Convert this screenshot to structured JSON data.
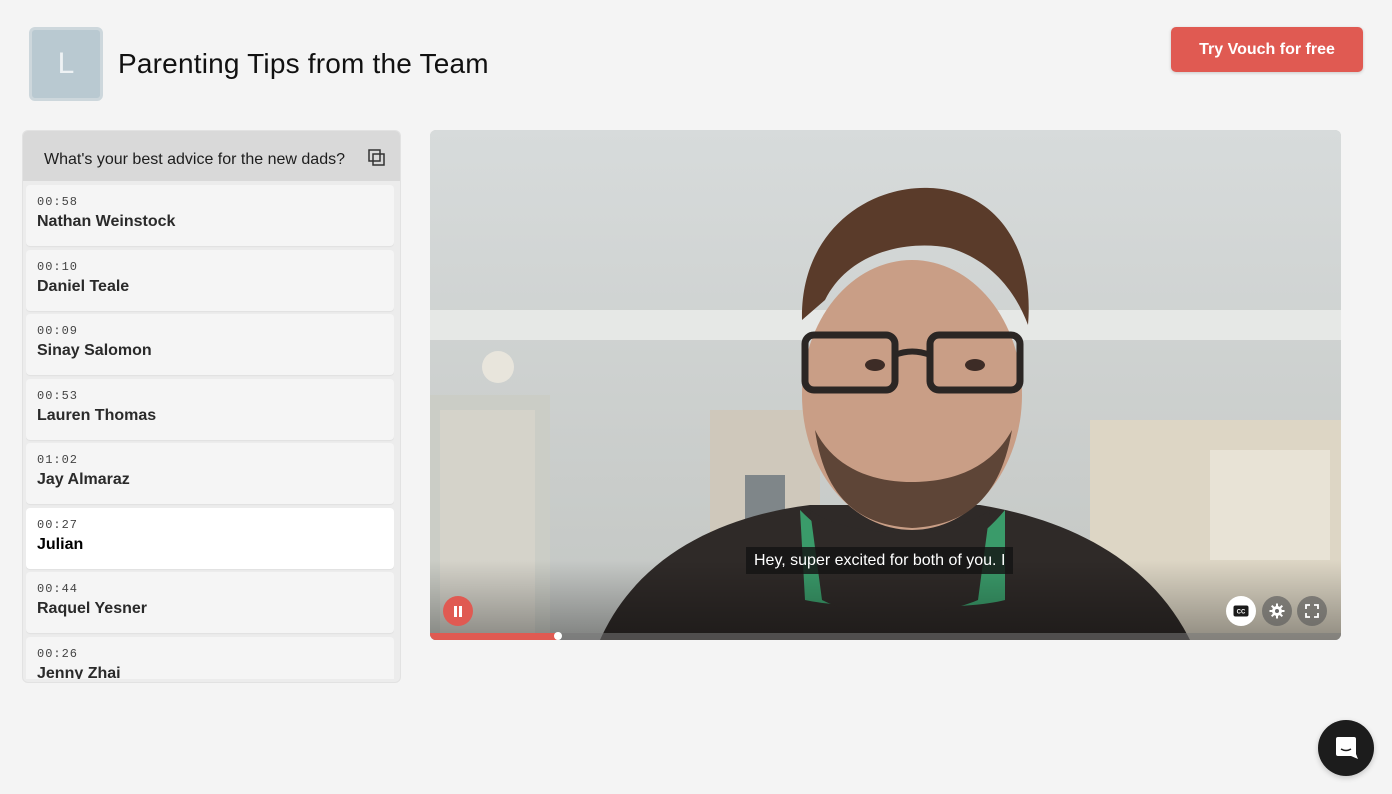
{
  "header": {
    "avatar_letter": "L",
    "title": "Parenting Tips from the Team",
    "cta_label": "Try Vouch for free"
  },
  "sidebar": {
    "question": "What's your best advice for the new dads?",
    "items": [
      {
        "time": "00:58",
        "name": "Nathan Weinstock"
      },
      {
        "time": "00:10",
        "name": "Daniel Teale"
      },
      {
        "time": "00:09",
        "name": "Sinay Salomon"
      },
      {
        "time": "00:53",
        "name": "Lauren Thomas"
      },
      {
        "time": "01:02",
        "name": "Jay Almaraz"
      },
      {
        "time": "00:27",
        "name": "Julian"
      },
      {
        "time": "00:44",
        "name": "Raquel Yesner"
      },
      {
        "time": "00:26",
        "name": "Jenny Zhai"
      }
    ],
    "active_index": 5
  },
  "player": {
    "caption": "Hey, super excited for both of you. I",
    "progress": 0.14,
    "cc_label": "CC"
  },
  "colors": {
    "accent": "#e05a52",
    "background": "#f4f4f4"
  },
  "icons": [
    "copy-icon",
    "pause-icon",
    "cc-icon",
    "settings-icon",
    "fullscreen-icon",
    "chat-icon"
  ]
}
